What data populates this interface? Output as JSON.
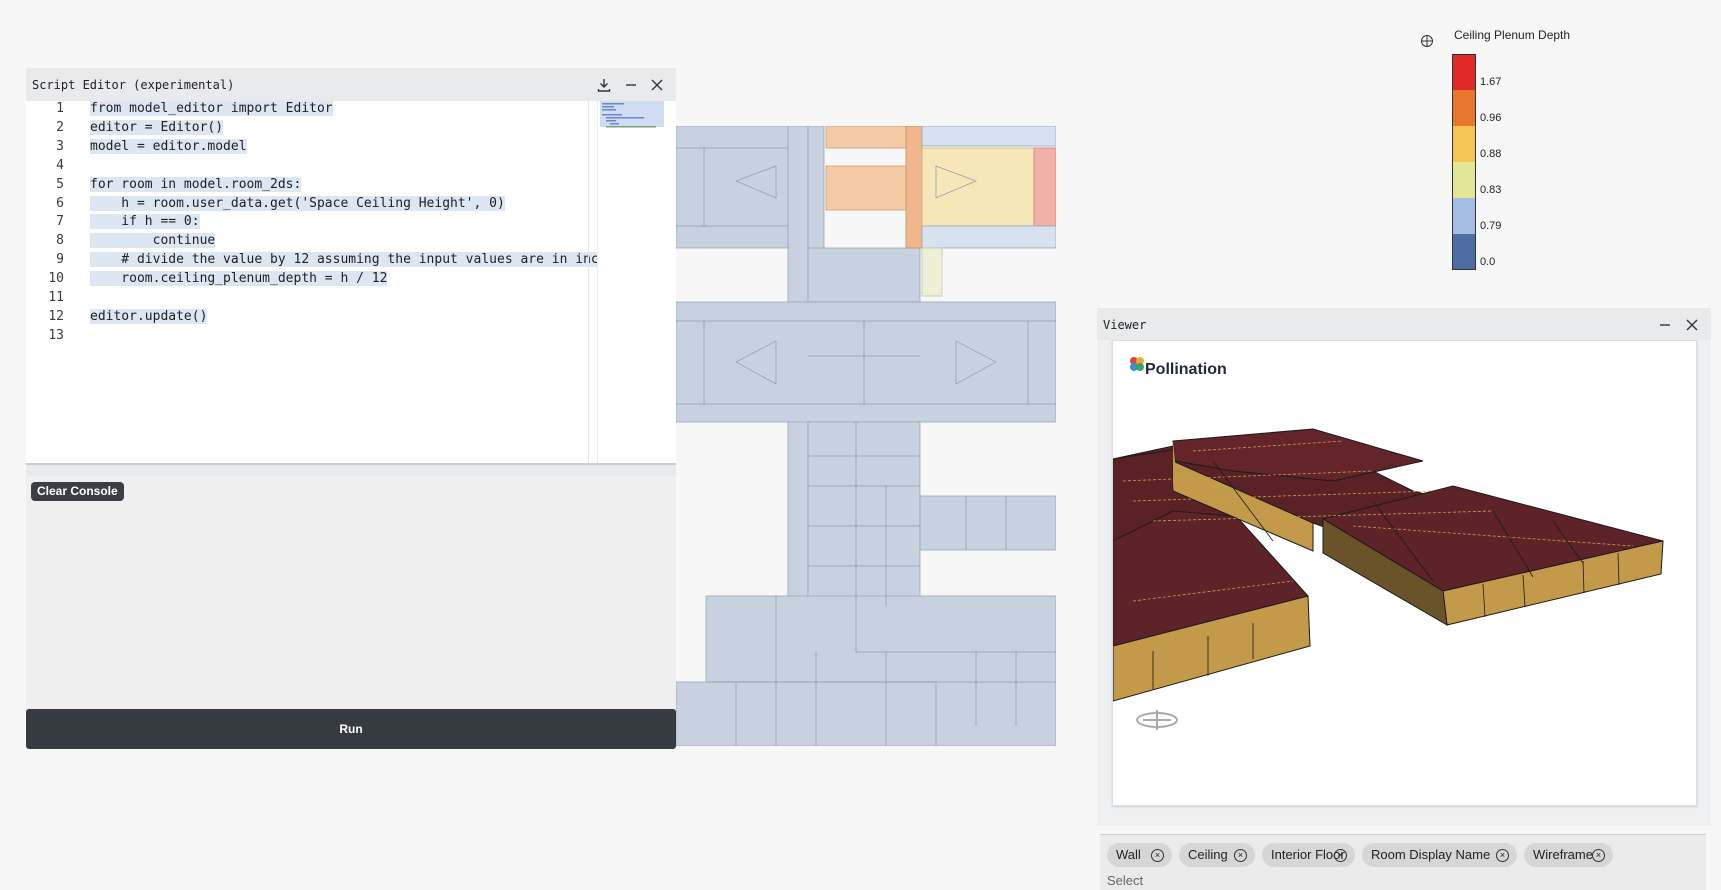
{
  "editor": {
    "title": "Script Editor (experimental)",
    "lines": [
      {
        "n": "1",
        "t": "from model_editor import Editor"
      },
      {
        "n": "2",
        "t": "editor = Editor()"
      },
      {
        "n": "3",
        "t": "model = editor.model"
      },
      {
        "n": "4",
        "t": ""
      },
      {
        "n": "5",
        "t": "for room in model.room_2ds:"
      },
      {
        "n": "6",
        "t": "    h = room.user_data.get('Space Ceiling Height', 0)"
      },
      {
        "n": "7",
        "t": "    if h == 0:"
      },
      {
        "n": "8",
        "t": "        continue"
      },
      {
        "n": "9",
        "t": "    # divide the value by 12 assuming the input values are in inc"
      },
      {
        "n": "10",
        "t": "    room.ceiling_plenum_depth = h / 12"
      },
      {
        "n": "11",
        "t": ""
      },
      {
        "n": "12",
        "t": "editor.update()"
      },
      {
        "n": "13",
        "t": ""
      }
    ]
  },
  "console": {
    "clear_label": "Clear Console"
  },
  "run_label": "Run",
  "legend": {
    "title": "Ceiling Plenum Depth",
    "bins": [
      {
        "label": "1.67",
        "color": "#e02a2a"
      },
      {
        "label": "0.96",
        "color": "#e9762f"
      },
      {
        "label": "0.88",
        "color": "#f3c654"
      },
      {
        "label": "0.83",
        "color": "#e3e597"
      },
      {
        "label": "0.79",
        "color": "#a5bde3"
      },
      {
        "label": "0.0",
        "color": "#4e6ea3"
      }
    ]
  },
  "viewer": {
    "title": "Viewer",
    "brand": "Pollination",
    "chips": [
      "Wall",
      "Ceiling",
      "Interior Floor",
      "Room Display Name",
      "Wireframe"
    ],
    "select_placeholder": "Select"
  }
}
